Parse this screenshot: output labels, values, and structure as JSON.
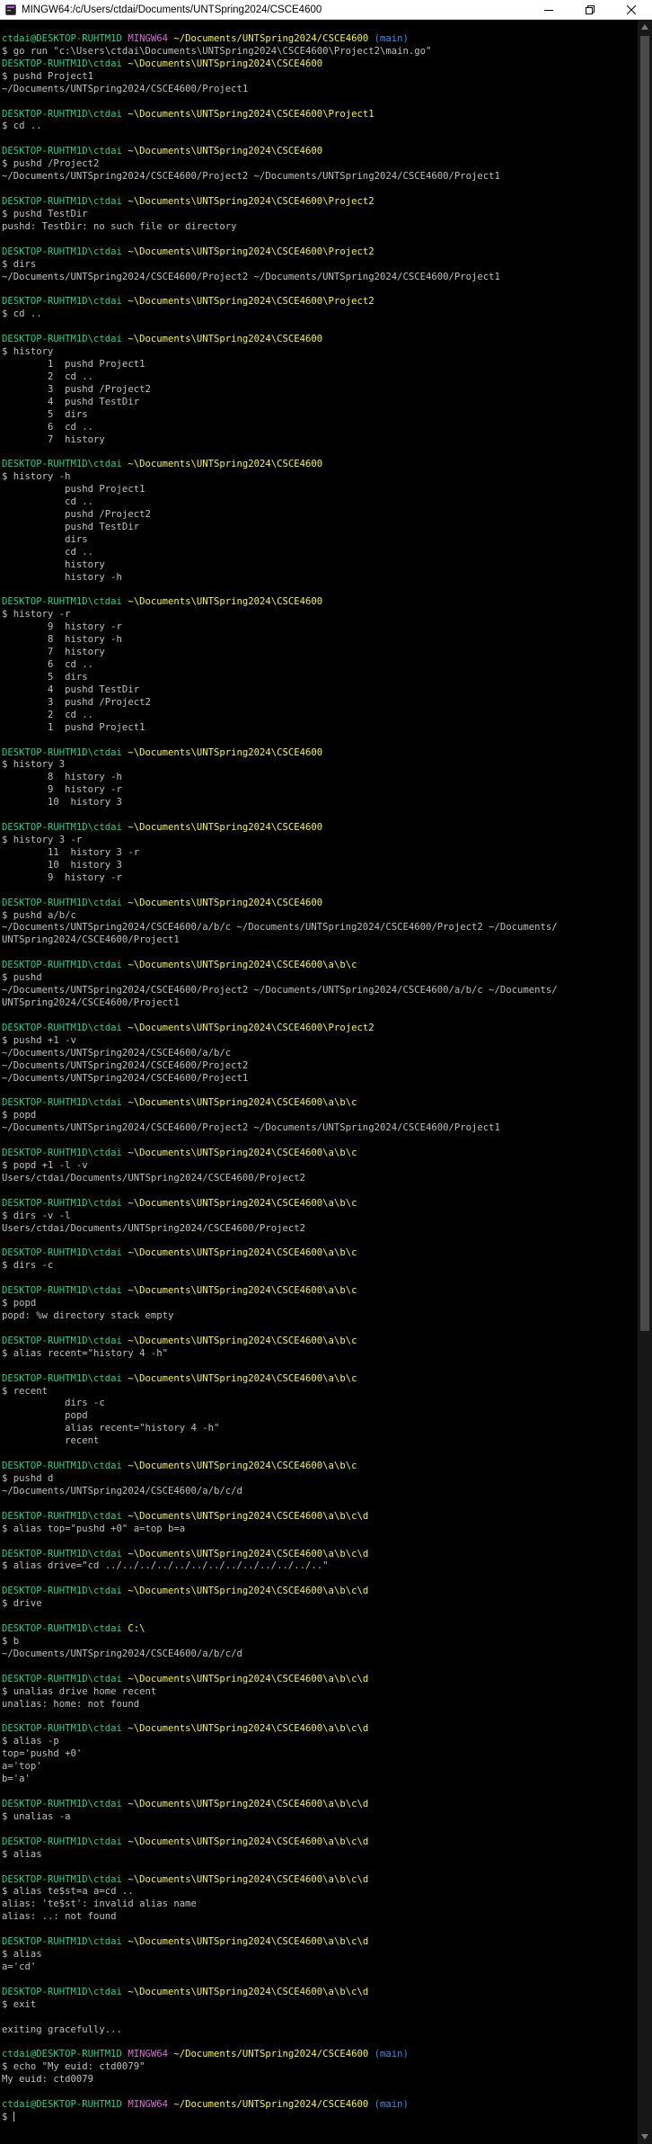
{
  "window": {
    "title": "MINGW64:/c/Users/ctdai/Documents/UNTSpring2024/CSCE4600",
    "app_icon": "mintty-terminal-icon",
    "controls": [
      "minimize-icon",
      "maximize-icon",
      "close-icon"
    ]
  },
  "colors": {
    "background": "#000000",
    "default_text": "#c0c0c0",
    "user_host": "#23d18b",
    "path": "#f5f543",
    "mingw": "#d670d6",
    "branch": "#3b8eea"
  },
  "terminal": {
    "lines": [
      [
        {
          "t": "ctdai@DESKTOP-RUHTM1D ",
          "c": "g"
        },
        {
          "t": "MINGW64 ",
          "c": "m"
        },
        {
          "t": "~/Documents/UNTSpring2024/CSCE4600",
          "c": "y"
        },
        {
          "t": " (main)",
          "c": "b"
        }
      ],
      [
        {
          "t": "$ go run \"c:\\Users\\ctdai\\Documents\\UNTSpring2024\\CSCE4600\\Project2\\main.go\""
        }
      ],
      [
        {
          "t": "DESKTOP-RUHTM1D\\ctdai ",
          "c": "g"
        },
        {
          "t": "~\\Documents\\UNTSpring2024\\CSCE4600",
          "c": "y"
        }
      ],
      [
        {
          "t": "$ pushd Project1"
        }
      ],
      [
        {
          "t": "~/Documents/UNTSpring2024/CSCE4600/Project1"
        }
      ],
      [],
      [
        {
          "t": "DESKTOP-RUHTM1D\\ctdai ",
          "c": "g"
        },
        {
          "t": "~\\Documents\\UNTSpring2024\\CSCE4600\\Project1",
          "c": "y"
        }
      ],
      [
        {
          "t": "$ cd .."
        }
      ],
      [],
      [
        {
          "t": "DESKTOP-RUHTM1D\\ctdai ",
          "c": "g"
        },
        {
          "t": "~\\Documents\\UNTSpring2024\\CSCE4600",
          "c": "y"
        }
      ],
      [
        {
          "t": "$ pushd /Project2"
        }
      ],
      [
        {
          "t": "~/Documents/UNTSpring2024/CSCE4600/Project2 ~/Documents/UNTSpring2024/CSCE4600/Project1"
        }
      ],
      [],
      [
        {
          "t": "DESKTOP-RUHTM1D\\ctdai ",
          "c": "g"
        },
        {
          "t": "~\\Documents\\UNTSpring2024\\CSCE4600\\Project2",
          "c": "y"
        }
      ],
      [
        {
          "t": "$ pushd TestDir"
        }
      ],
      [
        {
          "t": "pushd: TestDir: no such file or directory"
        }
      ],
      [],
      [
        {
          "t": "DESKTOP-RUHTM1D\\ctdai ",
          "c": "g"
        },
        {
          "t": "~\\Documents\\UNTSpring2024\\CSCE4600\\Project2",
          "c": "y"
        }
      ],
      [
        {
          "t": "$ dirs"
        }
      ],
      [
        {
          "t": "~/Documents/UNTSpring2024/CSCE4600/Project2 ~/Documents/UNTSpring2024/CSCE4600/Project1"
        }
      ],
      [],
      [
        {
          "t": "DESKTOP-RUHTM1D\\ctdai ",
          "c": "g"
        },
        {
          "t": "~\\Documents\\UNTSpring2024\\CSCE4600\\Project2",
          "c": "y"
        }
      ],
      [
        {
          "t": "$ cd .."
        }
      ],
      [],
      [
        {
          "t": "DESKTOP-RUHTM1D\\ctdai ",
          "c": "g"
        },
        {
          "t": "~\\Documents\\UNTSpring2024\\CSCE4600",
          "c": "y"
        }
      ],
      [
        {
          "t": "$ history"
        }
      ],
      [
        {
          "t": "        1  pushd Project1"
        }
      ],
      [
        {
          "t": "        2  cd .."
        }
      ],
      [
        {
          "t": "        3  pushd /Project2"
        }
      ],
      [
        {
          "t": "        4  pushd TestDir"
        }
      ],
      [
        {
          "t": "        5  dirs"
        }
      ],
      [
        {
          "t": "        6  cd .."
        }
      ],
      [
        {
          "t": "        7  history"
        }
      ],
      [],
      [
        {
          "t": "DESKTOP-RUHTM1D\\ctdai ",
          "c": "g"
        },
        {
          "t": "~\\Documents\\UNTSpring2024\\CSCE4600",
          "c": "y"
        }
      ],
      [
        {
          "t": "$ history -h"
        }
      ],
      [
        {
          "t": "           pushd Project1"
        }
      ],
      [
        {
          "t": "           cd .."
        }
      ],
      [
        {
          "t": "           pushd /Project2"
        }
      ],
      [
        {
          "t": "           pushd TestDir"
        }
      ],
      [
        {
          "t": "           dirs"
        }
      ],
      [
        {
          "t": "           cd .."
        }
      ],
      [
        {
          "t": "           history"
        }
      ],
      [
        {
          "t": "           history -h"
        }
      ],
      [],
      [
        {
          "t": "DESKTOP-RUHTM1D\\ctdai ",
          "c": "g"
        },
        {
          "t": "~\\Documents\\UNTSpring2024\\CSCE4600",
          "c": "y"
        }
      ],
      [
        {
          "t": "$ history -r"
        }
      ],
      [
        {
          "t": "        9  history -r"
        }
      ],
      [
        {
          "t": "        8  history -h"
        }
      ],
      [
        {
          "t": "        7  history"
        }
      ],
      [
        {
          "t": "        6  cd .."
        }
      ],
      [
        {
          "t": "        5  dirs"
        }
      ],
      [
        {
          "t": "        4  pushd TestDir"
        }
      ],
      [
        {
          "t": "        3  pushd /Project2"
        }
      ],
      [
        {
          "t": "        2  cd .."
        }
      ],
      [
        {
          "t": "        1  pushd Project1"
        }
      ],
      [],
      [
        {
          "t": "DESKTOP-RUHTM1D\\ctdai ",
          "c": "g"
        },
        {
          "t": "~\\Documents\\UNTSpring2024\\CSCE4600",
          "c": "y"
        }
      ],
      [
        {
          "t": "$ history 3"
        }
      ],
      [
        {
          "t": "        8  history -h"
        }
      ],
      [
        {
          "t": "        9  history -r"
        }
      ],
      [
        {
          "t": "        10  history 3"
        }
      ],
      [],
      [
        {
          "t": "DESKTOP-RUHTM1D\\ctdai ",
          "c": "g"
        },
        {
          "t": "~\\Documents\\UNTSpring2024\\CSCE4600",
          "c": "y"
        }
      ],
      [
        {
          "t": "$ history 3 -r"
        }
      ],
      [
        {
          "t": "        11  history 3 -r"
        }
      ],
      [
        {
          "t": "        10  history 3"
        }
      ],
      [
        {
          "t": "        9  history -r"
        }
      ],
      [],
      [
        {
          "t": "DESKTOP-RUHTM1D\\ctdai ",
          "c": "g"
        },
        {
          "t": "~\\Documents\\UNTSpring2024\\CSCE4600",
          "c": "y"
        }
      ],
      [
        {
          "t": "$ pushd a/b/c"
        }
      ],
      [
        {
          "t": "~/Documents/UNTSpring2024/CSCE4600/a/b/c ~/Documents/UNTSpring2024/CSCE4600/Project2 ~/Documents/"
        }
      ],
      [
        {
          "t": "UNTSpring2024/CSCE4600/Project1"
        }
      ],
      [],
      [
        {
          "t": "DESKTOP-RUHTM1D\\ctdai ",
          "c": "g"
        },
        {
          "t": "~\\Documents\\UNTSpring2024\\CSCE4600\\a\\b\\c",
          "c": "y"
        }
      ],
      [
        {
          "t": "$ pushd"
        }
      ],
      [
        {
          "t": "~/Documents/UNTSpring2024/CSCE4600/Project2 ~/Documents/UNTSpring2024/CSCE4600/a/b/c ~/Documents/"
        }
      ],
      [
        {
          "t": "UNTSpring2024/CSCE4600/Project1"
        }
      ],
      [],
      [
        {
          "t": "DESKTOP-RUHTM1D\\ctdai ",
          "c": "g"
        },
        {
          "t": "~\\Documents\\UNTSpring2024\\CSCE4600\\Project2",
          "c": "y"
        }
      ],
      [
        {
          "t": "$ pushd +1 -v"
        }
      ],
      [
        {
          "t": "~/Documents/UNTSpring2024/CSCE4600/a/b/c"
        }
      ],
      [
        {
          "t": "~/Documents/UNTSpring2024/CSCE4600/Project2"
        }
      ],
      [
        {
          "t": "~/Documents/UNTSpring2024/CSCE4600/Project1"
        }
      ],
      [],
      [
        {
          "t": "DESKTOP-RUHTM1D\\ctdai ",
          "c": "g"
        },
        {
          "t": "~\\Documents\\UNTSpring2024\\CSCE4600\\a\\b\\c",
          "c": "y"
        }
      ],
      [
        {
          "t": "$ popd"
        }
      ],
      [
        {
          "t": "~/Documents/UNTSpring2024/CSCE4600/Project2 ~/Documents/UNTSpring2024/CSCE4600/Project1"
        }
      ],
      [],
      [
        {
          "t": "DESKTOP-RUHTM1D\\ctdai ",
          "c": "g"
        },
        {
          "t": "~\\Documents\\UNTSpring2024\\CSCE4600\\a\\b\\c",
          "c": "y"
        }
      ],
      [
        {
          "t": "$ popd +1 -l -v"
        }
      ],
      [
        {
          "t": "Users/ctdai/Documents/UNTSpring2024/CSCE4600/Project2"
        }
      ],
      [],
      [
        {
          "t": "DESKTOP-RUHTM1D\\ctdai ",
          "c": "g"
        },
        {
          "t": "~\\Documents\\UNTSpring2024\\CSCE4600\\a\\b\\c",
          "c": "y"
        }
      ],
      [
        {
          "t": "$ dirs -v -l"
        }
      ],
      [
        {
          "t": "Users/ctdai/Documents/UNTSpring2024/CSCE4600/Project2"
        }
      ],
      [],
      [
        {
          "t": "DESKTOP-RUHTM1D\\ctdai ",
          "c": "g"
        },
        {
          "t": "~\\Documents\\UNTSpring2024\\CSCE4600\\a\\b\\c",
          "c": "y"
        }
      ],
      [
        {
          "t": "$ dirs -c"
        }
      ],
      [],
      [
        {
          "t": "DESKTOP-RUHTM1D\\ctdai ",
          "c": "g"
        },
        {
          "t": "~\\Documents\\UNTSpring2024\\CSCE4600\\a\\b\\c",
          "c": "y"
        }
      ],
      [
        {
          "t": "$ popd"
        }
      ],
      [
        {
          "t": "popd: %w directory stack empty"
        }
      ],
      [],
      [
        {
          "t": "DESKTOP-RUHTM1D\\ctdai ",
          "c": "g"
        },
        {
          "t": "~\\Documents\\UNTSpring2024\\CSCE4600\\a\\b\\c",
          "c": "y"
        }
      ],
      [
        {
          "t": "$ alias recent=\"history 4 -h\""
        }
      ],
      [],
      [
        {
          "t": "DESKTOP-RUHTM1D\\ctdai ",
          "c": "g"
        },
        {
          "t": "~\\Documents\\UNTSpring2024\\CSCE4600\\a\\b\\c",
          "c": "y"
        }
      ],
      [
        {
          "t": "$ recent"
        }
      ],
      [
        {
          "t": "           dirs -c"
        }
      ],
      [
        {
          "t": "           popd"
        }
      ],
      [
        {
          "t": "           alias recent=\"history 4 -h\""
        }
      ],
      [
        {
          "t": "           recent"
        }
      ],
      [],
      [
        {
          "t": "DESKTOP-RUHTM1D\\ctdai ",
          "c": "g"
        },
        {
          "t": "~\\Documents\\UNTSpring2024\\CSCE4600\\a\\b\\c",
          "c": "y"
        }
      ],
      [
        {
          "t": "$ pushd d"
        }
      ],
      [
        {
          "t": "~/Documents/UNTSpring2024/CSCE4600/a/b/c/d"
        }
      ],
      [],
      [
        {
          "t": "DESKTOP-RUHTM1D\\ctdai ",
          "c": "g"
        },
        {
          "t": "~\\Documents\\UNTSpring2024\\CSCE4600\\a\\b\\c\\d",
          "c": "y"
        }
      ],
      [
        {
          "t": "$ alias top=\"pushd +0\" a=top b=a"
        }
      ],
      [],
      [
        {
          "t": "DESKTOP-RUHTM1D\\ctdai ",
          "c": "g"
        },
        {
          "t": "~\\Documents\\UNTSpring2024\\CSCE4600\\a\\b\\c\\d",
          "c": "y"
        }
      ],
      [
        {
          "t": "$ alias drive=\"cd ../../../../../../../../../../../../..\""
        }
      ],
      [],
      [
        {
          "t": "DESKTOP-RUHTM1D\\ctdai ",
          "c": "g"
        },
        {
          "t": "~\\Documents\\UNTSpring2024\\CSCE4600\\a\\b\\c\\d",
          "c": "y"
        }
      ],
      [
        {
          "t": "$ drive"
        }
      ],
      [],
      [
        {
          "t": "DESKTOP-RUHTM1D\\ctdai ",
          "c": "g"
        },
        {
          "t": "C:\\",
          "c": "y"
        }
      ],
      [
        {
          "t": "$ b"
        }
      ],
      [
        {
          "t": "~/Documents/UNTSpring2024/CSCE4600/a/b/c/d"
        }
      ],
      [],
      [
        {
          "t": "DESKTOP-RUHTM1D\\ctdai ",
          "c": "g"
        },
        {
          "t": "~\\Documents\\UNTSpring2024\\CSCE4600\\a\\b\\c\\d",
          "c": "y"
        }
      ],
      [
        {
          "t": "$ unalias drive home recent"
        }
      ],
      [
        {
          "t": "unalias: home: not found"
        }
      ],
      [],
      [
        {
          "t": "DESKTOP-RUHTM1D\\ctdai ",
          "c": "g"
        },
        {
          "t": "~\\Documents\\UNTSpring2024\\CSCE4600\\a\\b\\c\\d",
          "c": "y"
        }
      ],
      [
        {
          "t": "$ alias -p"
        }
      ],
      [
        {
          "t": "top='pushd +0'"
        }
      ],
      [
        {
          "t": "a='top'"
        }
      ],
      [
        {
          "t": "b='a'"
        }
      ],
      [],
      [
        {
          "t": "DESKTOP-RUHTM1D\\ctdai ",
          "c": "g"
        },
        {
          "t": "~\\Documents\\UNTSpring2024\\CSCE4600\\a\\b\\c\\d",
          "c": "y"
        }
      ],
      [
        {
          "t": "$ unalias -a"
        }
      ],
      [],
      [
        {
          "t": "DESKTOP-RUHTM1D\\ctdai ",
          "c": "g"
        },
        {
          "t": "~\\Documents\\UNTSpring2024\\CSCE4600\\a\\b\\c\\d",
          "c": "y"
        }
      ],
      [
        {
          "t": "$ alias"
        }
      ],
      [],
      [
        {
          "t": "DESKTOP-RUHTM1D\\ctdai ",
          "c": "g"
        },
        {
          "t": "~\\Documents\\UNTSpring2024\\CSCE4600\\a\\b\\c\\d",
          "c": "y"
        }
      ],
      [
        {
          "t": "$ alias te$st=a a=cd .."
        }
      ],
      [
        {
          "t": "alias: 'te$st': invalid alias name"
        }
      ],
      [
        {
          "t": "alias: ..: not found"
        }
      ],
      [],
      [
        {
          "t": "DESKTOP-RUHTM1D\\ctdai ",
          "c": "g"
        },
        {
          "t": "~\\Documents\\UNTSpring2024\\CSCE4600\\a\\b\\c\\d",
          "c": "y"
        }
      ],
      [
        {
          "t": "$ alias"
        }
      ],
      [
        {
          "t": "a='cd'"
        }
      ],
      [],
      [
        {
          "t": "DESKTOP-RUHTM1D\\ctdai ",
          "c": "g"
        },
        {
          "t": "~\\Documents\\UNTSpring2024\\CSCE4600\\a\\b\\c\\d",
          "c": "y"
        }
      ],
      [
        {
          "t": "$ exit"
        }
      ],
      [],
      [
        {
          "t": "exiting gracefully..."
        }
      ],
      [],
      [
        {
          "t": "ctdai@DESKTOP-RUHTM1D ",
          "c": "g"
        },
        {
          "t": "MINGW64 ",
          "c": "m"
        },
        {
          "t": "~/Documents/UNTSpring2024/CSCE4600",
          "c": "y"
        },
        {
          "t": " (main)",
          "c": "b"
        }
      ],
      [
        {
          "t": "$ echo \"My euid: ctd0079\""
        }
      ],
      [
        {
          "t": "My euid: ctd0079"
        }
      ],
      [],
      [
        {
          "t": "ctdai@DESKTOP-RUHTM1D ",
          "c": "g"
        },
        {
          "t": "MINGW64 ",
          "c": "m"
        },
        {
          "t": "~/Documents/UNTSpring2024/CSCE4600",
          "c": "y"
        },
        {
          "t": " (main)",
          "c": "b"
        }
      ],
      [
        {
          "t": "$ "
        }
      ]
    ]
  },
  "scrollbar": {
    "up_icon": "scroll-up-arrow-icon",
    "down_icon": "scroll-down-arrow-icon"
  }
}
